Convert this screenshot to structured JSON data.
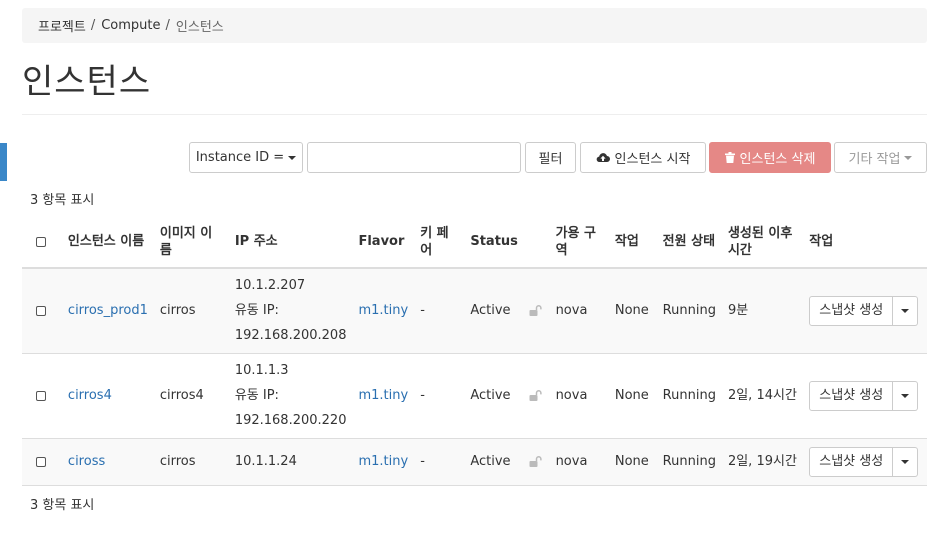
{
  "breadcrumb": {
    "items": [
      "프로젝트",
      "Compute",
      "인스턴스"
    ],
    "separator": "/"
  },
  "page_title": "인스턴스",
  "toolbar": {
    "filter_field": "Instance ID =",
    "filter_value": "",
    "filter_button": "필터",
    "start_button": "인스턴스 시작",
    "delete_button": "인스턴스 삭제",
    "more_button": "기타 작업"
  },
  "count_text": "3 항목 표시",
  "table": {
    "headers": {
      "name": "인스턴스 이름",
      "image": "이미지 이름",
      "ip": "IP 주소",
      "flavor": "Flavor",
      "keypair": "키 페어",
      "status": "Status",
      "az": "가용 구역",
      "task": "작업",
      "power": "전원 상태",
      "age": "생성된 이후 시간",
      "actions": "작업"
    },
    "rows": [
      {
        "name": "cirros_prod1",
        "image": "cirros",
        "ip_fixed": "10.1.2.207",
        "ip_float_label": "유동 IP:",
        "ip_float": "192.168.200.208",
        "flavor": "m1.tiny",
        "keypair": "-",
        "status": "Active",
        "az": "nova",
        "task": "None",
        "power": "Running",
        "age": "9분",
        "action": "스냅샷 생성"
      },
      {
        "name": "cirros4",
        "image": "cirros4",
        "ip_fixed": "10.1.1.3",
        "ip_float_label": "유동 IP:",
        "ip_float": "192.168.200.220",
        "flavor": "m1.tiny",
        "keypair": "-",
        "status": "Active",
        "az": "nova",
        "task": "None",
        "power": "Running",
        "age": "2일, 14시간",
        "action": "스냅샷 생성"
      },
      {
        "name": "ciross",
        "image": "cirros",
        "ip_fixed": "10.1.1.24",
        "flavor": "m1.tiny",
        "keypair": "-",
        "status": "Active",
        "az": "nova",
        "task": "None",
        "power": "Running",
        "age": "2일, 19시간",
        "action": "스냅샷 생성"
      }
    ]
  },
  "icons": {
    "start": "cloud-upload-icon",
    "delete": "trash-icon",
    "lock": "unlock-icon"
  },
  "colors": {
    "link": "#2a6fb0",
    "danger": "#e58886",
    "accent": "#3a87c8"
  }
}
